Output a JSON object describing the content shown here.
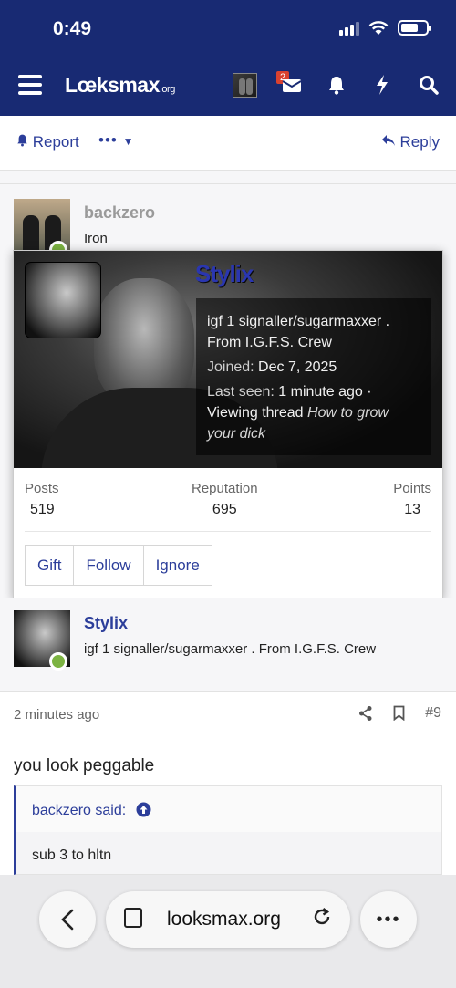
{
  "status": {
    "time": "0:49"
  },
  "nav": {
    "logo_main": "Lœksmax",
    "logo_suffix": ".org",
    "notification_count": "2"
  },
  "actions": {
    "report": "Report",
    "more": "•••",
    "reply": "Reply"
  },
  "post1": {
    "username": "backzero",
    "rank": "Iron"
  },
  "card": {
    "username": "Stylix",
    "title": "igf 1 signaller/sugarmaxxer . From I.G.F.S. Crew",
    "joined_label": "Joined:",
    "joined_value": "Dec 7, 2025",
    "last_seen_label": "Last seen:",
    "last_seen_value": "1 minute ago ·",
    "activity_prefix": "Viewing thread",
    "activity_thread": "How to grow your dick",
    "stats": [
      {
        "label": "Posts",
        "value": "519"
      },
      {
        "label": "Reputation",
        "value": "695"
      },
      {
        "label": "Points",
        "value": "13"
      }
    ],
    "buttons": [
      "Gift",
      "Follow",
      "Ignore"
    ]
  },
  "post2": {
    "username": "Stylix",
    "rank": "igf 1 signaller/sugarmaxxer . From I.G.F.S. Crew",
    "timestamp": "2 minutes ago",
    "post_number": "#9",
    "message": "you look peggable",
    "quote_author": "backzero said:",
    "quote_text": "sub 3 to hltn"
  },
  "browser": {
    "url": "looksmax.org",
    "more": "•••"
  },
  "colors": {
    "header": "#182a73",
    "link": "#2c3e9a",
    "online": "#7cb342",
    "badge": "#d9412f"
  }
}
